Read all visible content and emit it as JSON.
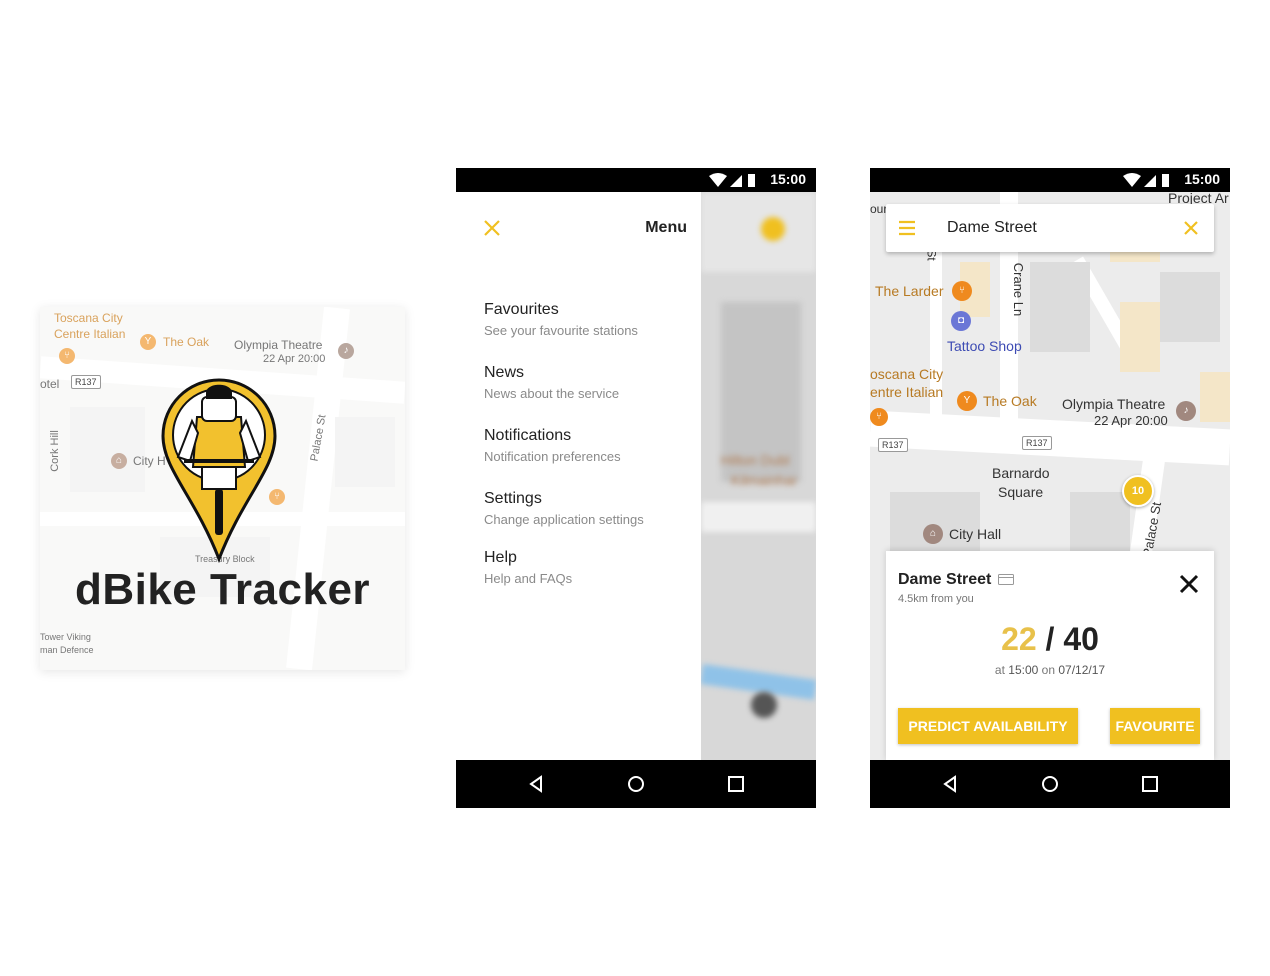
{
  "logo_card": {
    "title": "dBike Tracker",
    "map_labels": {
      "toscana_1": "Toscana City",
      "toscana_2": "Centre Italian",
      "the_oak": "The Oak",
      "olympia": "Olympia Theatre",
      "olympia_date": "22 Apr 20:00",
      "route": "R137",
      "city_hall": "City H",
      "cork_hill": "Cork Hill",
      "palace_st": "Palace St",
      "treasury": "Treasury Block",
      "tower_1": "Tower Viking",
      "tower_2": "man Defence",
      "otel": "otel"
    }
  },
  "status": {
    "time": "15:00"
  },
  "menu_screen": {
    "title": "Menu",
    "items": [
      {
        "label": "Favourites",
        "subtitle": "See your favourite stations"
      },
      {
        "label": "News",
        "subtitle": "News about the service"
      },
      {
        "label": "Notifications",
        "subtitle": "Notification preferences"
      },
      {
        "label": "Settings",
        "subtitle": "Change application settings"
      },
      {
        "label": "Help",
        "subtitle": "Help and FAQs"
      }
    ],
    "blurred_labels": {
      "hilton_1": "Hilton Dubl",
      "hilton_2": "Kilmainhar"
    }
  },
  "map_screen": {
    "search_text": "Dame Street",
    "map_labels": {
      "project": "Project Ar",
      "the_larder": "The Larder",
      "tattoo": "Tattoo Shop",
      "toscana_1": "oscana City",
      "toscana_2": "entre Italian",
      "the_oak": "The Oak",
      "olympia": "Olympia Theatre",
      "olympia_date": "22 Apr 20:00",
      "crane_ln": "Crane Ln",
      "route_a": "R137",
      "route_b": "R137",
      "barnardo_1": "Barnardo",
      "barnardo_2": "Square",
      "city_hall": "City Hall",
      "palace_st": "Palace St",
      "our": "our",
      "st": "St"
    },
    "station_pin": "10",
    "card": {
      "name": "Dame Street",
      "distance": "4.5km from you",
      "available": "22",
      "separator": "/",
      "total": "40",
      "time_prefix": "at",
      "time": "15:00",
      "date_prefix": "on",
      "date": "07/12/17",
      "predict_label": "PREDICT AVAILABILITY",
      "favourite_label": "FAVOURITE"
    }
  },
  "colors": {
    "accent": "#f0c020",
    "available": "#e8c14a",
    "poi_orange": "#ef8a1e"
  }
}
